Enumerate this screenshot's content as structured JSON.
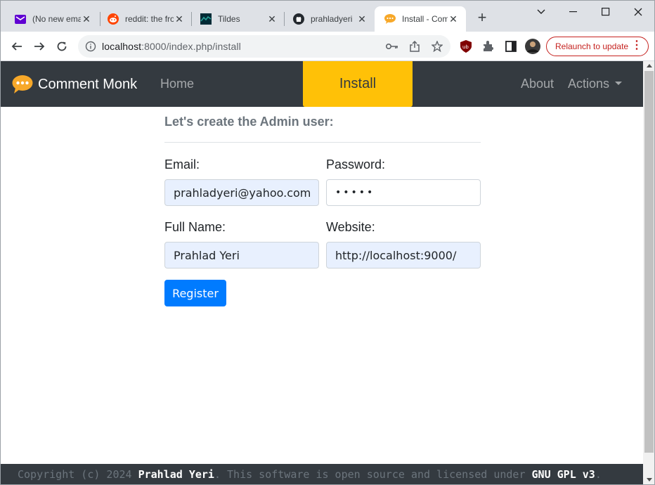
{
  "browser": {
    "tabs": [
      {
        "title": "(No new emails)",
        "icon": "mail-icon"
      },
      {
        "title": "reddit: the front page",
        "icon": "reddit-icon"
      },
      {
        "title": "Tildes",
        "icon": "tildes-icon"
      },
      {
        "title": "prahladyeri",
        "icon": "github-icon"
      },
      {
        "title": "Install - Comment Monk",
        "icon": "comment-icon"
      }
    ],
    "url_host": "localhost",
    "url_rest": ":8000/index.php/install",
    "relaunch_label": "Relaunch to update"
  },
  "navbar": {
    "brand": "Comment Monk",
    "home": "Home",
    "install": "Install",
    "about": "About",
    "actions": "Actions"
  },
  "form": {
    "heading": "Let's create the Admin user:",
    "email_label": "Email:",
    "email_value": "prahladyeri@yahoo.com",
    "password_label": "Password:",
    "password_value": "•••••",
    "fullname_label": "Full Name:",
    "fullname_value": "Prahlad Yeri",
    "website_label": "Website:",
    "website_value": "http://localhost:9000/",
    "register_label": "Register"
  },
  "footer": {
    "prefix": "Copyright (c) 2024 ",
    "author": "Prahlad Yeri",
    "middle": ". This software is open source and licensed under ",
    "license": "GNU GPL v3",
    "suffix": "."
  },
  "colors": {
    "navbar_bg": "#343a40",
    "install_accent": "#ffc107",
    "button_primary": "#007bff",
    "relaunch_red": "#c5221f"
  }
}
